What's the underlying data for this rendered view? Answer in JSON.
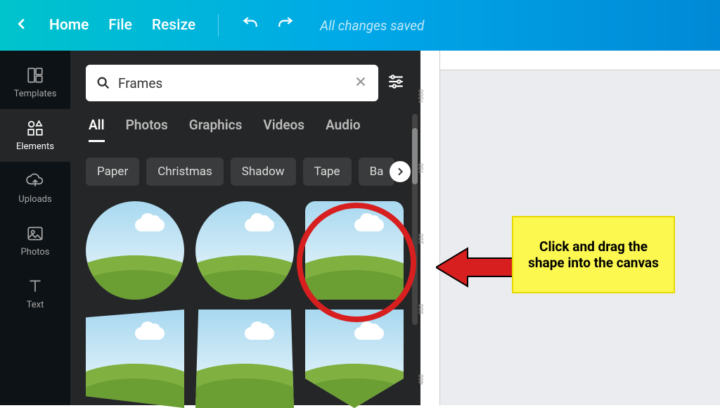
{
  "topbar": {
    "home": "Home",
    "file": "File",
    "resize": "Resize",
    "saved": "All changes saved"
  },
  "sidebar": {
    "items": [
      {
        "label": "Templates"
      },
      {
        "label": "Elements"
      },
      {
        "label": "Uploads"
      },
      {
        "label": "Photos"
      },
      {
        "label": "Text"
      }
    ]
  },
  "search": {
    "value": "Frames"
  },
  "tabs": [
    {
      "label": "All",
      "active": true
    },
    {
      "label": "Photos"
    },
    {
      "label": "Graphics"
    },
    {
      "label": "Videos"
    },
    {
      "label": "Audio"
    }
  ],
  "chips": [
    "Paper",
    "Christmas",
    "Shadow",
    "Tape",
    "Ba"
  ],
  "ruler": [
    "1000",
    "100",
    "200",
    "300",
    "400"
  ],
  "callout": "Click and drag the shape into the canvas"
}
